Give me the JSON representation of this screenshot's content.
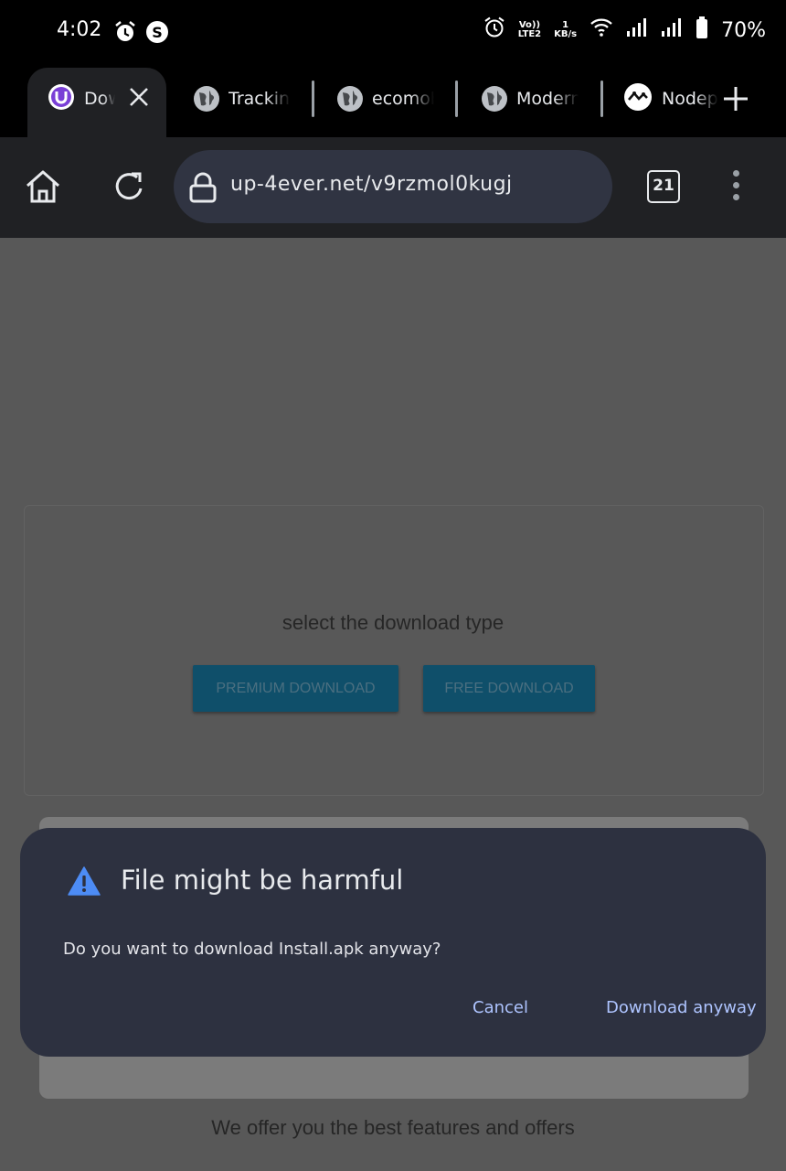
{
  "status_bar": {
    "time": "4:02",
    "net_speed_value": "1",
    "net_speed_unit": "KB/s",
    "volte_label": "Vo))",
    "lte_label": "LTE2",
    "battery": "70%"
  },
  "tabs": [
    {
      "title": "Dow",
      "icon": "uptodown-icon"
    },
    {
      "title": "Tracking",
      "icon": "globe-icon"
    },
    {
      "title": "ecomobi",
      "icon": "globe-icon"
    },
    {
      "title": "Modern",
      "icon": "globe-icon"
    },
    {
      "title": "Nodepa",
      "icon": "nodepay-icon"
    }
  ],
  "toolbar": {
    "url": "up-4ever.net/v9rzmol0kugj",
    "tab_count": "21"
  },
  "page": {
    "select_text": "select the download type",
    "premium_button": "PREMIUM DOWNLOAD",
    "free_button": "FREE DOWNLOAD",
    "offer_text": "We offer you the best features and offers"
  },
  "dialog": {
    "title": "File might be harmful",
    "message": "Do you want to download Install.apk anyway?",
    "cancel": "Cancel",
    "confirm": "Download anyway"
  },
  "colors": {
    "dialog_bg": "#2d3140",
    "accent_link": "#aec4ff",
    "warning": "#4d8cf5"
  }
}
